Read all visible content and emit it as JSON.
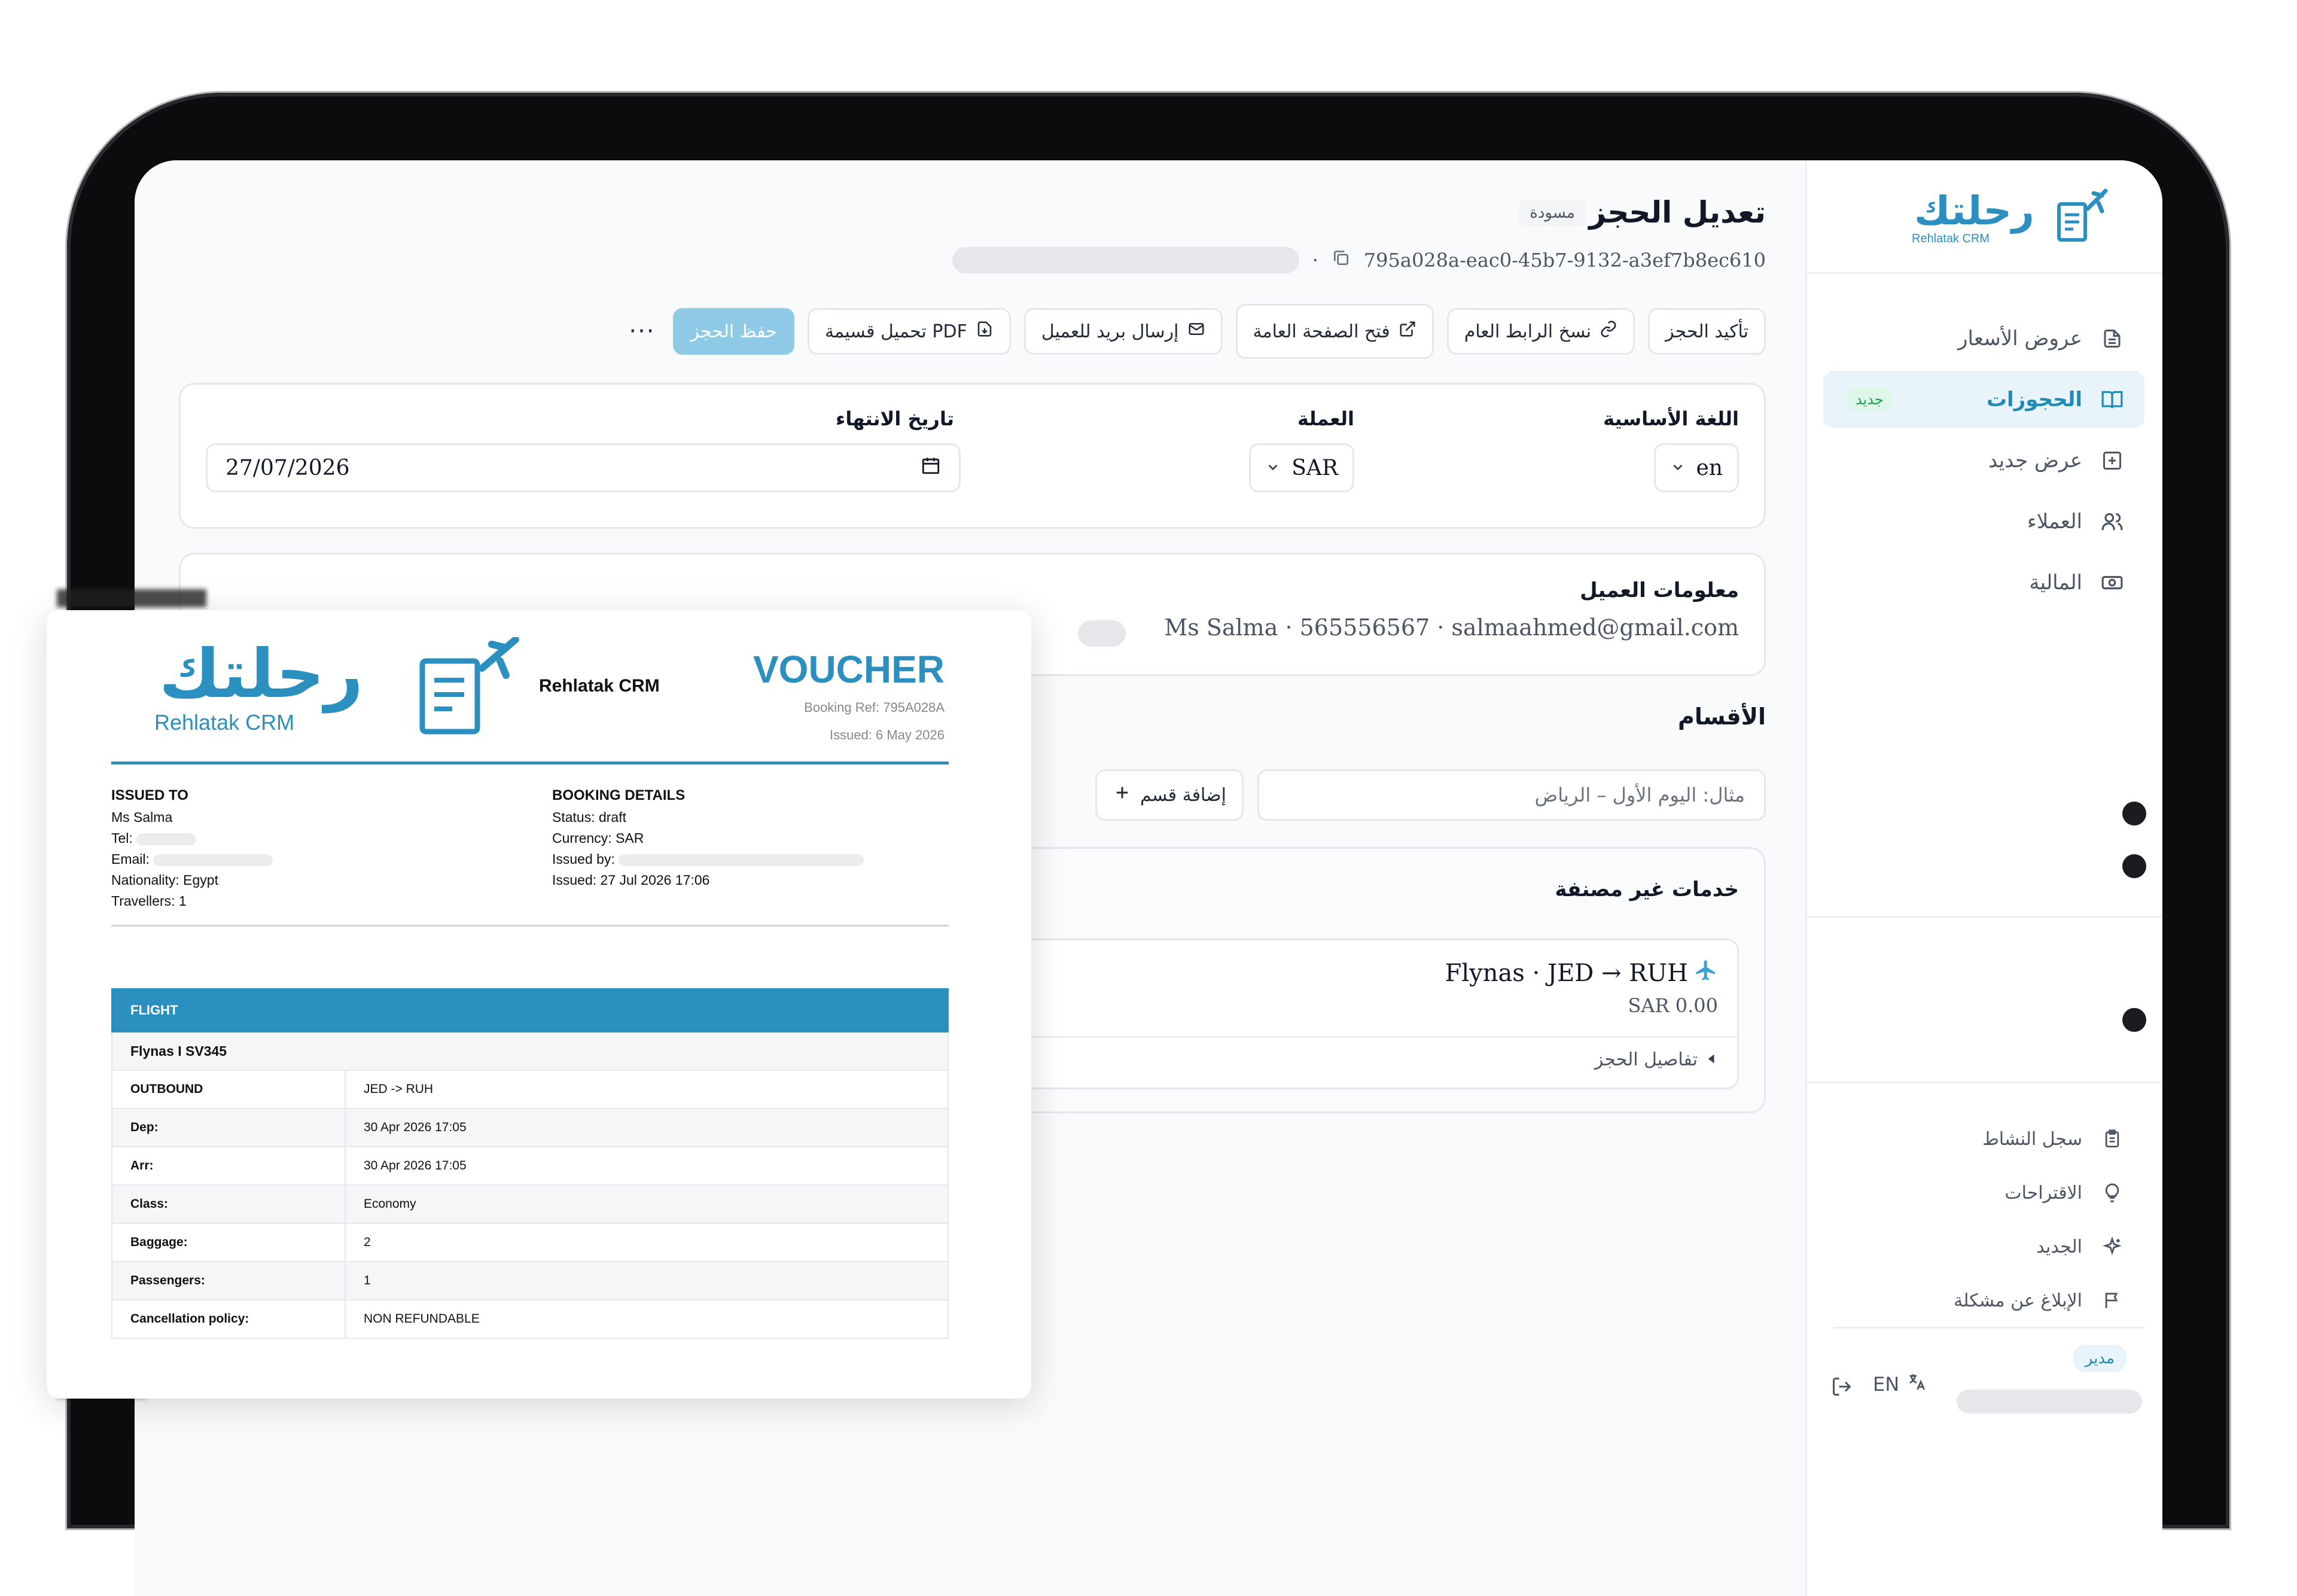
{
  "sidebar": {
    "logo_text": "رحلتك",
    "logo_sub": "Rehlatak CRM",
    "items": [
      {
        "label": "عروض الأسعار",
        "icon": "document-icon"
      },
      {
        "label": "الحجوزات",
        "icon": "book-icon",
        "badge": "جديد",
        "active": true
      },
      {
        "label": "عرض جديد",
        "icon": "plus-square-icon"
      },
      {
        "label": "العملاء",
        "icon": "users-icon"
      },
      {
        "label": "المالية",
        "icon": "cash-icon"
      }
    ],
    "bottom_items": [
      {
        "label": "سجل النشاط",
        "icon": "clipboard-icon"
      },
      {
        "label": "الاقتراحات",
        "icon": "lightbulb-icon"
      },
      {
        "label": "الجديد",
        "icon": "sparkles-icon"
      },
      {
        "label": "الإبلاغ عن مشكلة",
        "icon": "flag-icon"
      }
    ],
    "role": "مدير",
    "lang": "EN"
  },
  "header": {
    "title": "تعديل الحجز",
    "status": "مسودة",
    "booking_id": "795a028a-eac0-45b7-9132-a3ef7b8ec610",
    "separator": "·"
  },
  "actions": {
    "confirm": "تأكيد الحجز",
    "copy_link": "نسخ الرابط العام",
    "open_public": "فتح الصفحة العامة",
    "email_client": "إرسال بريد للعميل",
    "download_pdf": "تحميل قسيمة PDF",
    "save": "حفظ الحجز",
    "more": "···"
  },
  "settings": {
    "language_label": "اللغة الأساسية",
    "language_value": "en",
    "currency_label": "العملة",
    "currency_value": "SAR",
    "end_date_label": "تاريخ الانتهاء",
    "end_date_value": "27/07/2026"
  },
  "client": {
    "title": "معلومات العميل",
    "info": "Ms Salma · 565556567 · salmaahmed@gmail.com"
  },
  "sections": {
    "title": "الأقسام",
    "input_placeholder": "مثال: اليوم الأول – الرياض",
    "add_label": "إضافة قسم"
  },
  "services": {
    "title": "خدمات غير مصنفة",
    "item_name": "Flynas · JED → RUH",
    "item_price": "SAR 0.00",
    "details_label": "تفاصيل الحجز"
  },
  "voucher": {
    "company": "Rehlatak CRM",
    "title": "VOUCHER",
    "booking_ref": "Booking Ref: 795A028A",
    "issued": "Issued: 6 May 2026",
    "issued_to": {
      "heading": "ISSUED TO",
      "name": "Ms Salma",
      "tel": "Tel:",
      "email": "Email:",
      "nationality": "Nationality: Egypt",
      "travellers": "Travellers: 1"
    },
    "booking_details": {
      "heading": "BOOKING DETAILS",
      "status": "Status: draft",
      "currency": "Currency: SAR",
      "issued_by": "Issued by:",
      "issued_at": "Issued: 27 Jul 2026 17:06"
    },
    "flight": {
      "header": "FLIGHT",
      "name": "Flynas I SV345",
      "rows": [
        {
          "k": "OUTBOUND",
          "v": "JED -> RUH"
        },
        {
          "k": "Dep:",
          "v": "30 Apr 2026 17:05"
        },
        {
          "k": "Arr:",
          "v": "30 Apr 2026 17:05"
        },
        {
          "k": "Class:",
          "v": "Economy"
        },
        {
          "k": "Baggage:",
          "v": "2"
        },
        {
          "k": "Passengers:",
          "v": "1"
        },
        {
          "k": "Cancellation policy:",
          "v": "NON REFUNDABLE"
        }
      ]
    }
  },
  "colors": {
    "brand": "#2b8fbf",
    "primary_button": "#8ecae6",
    "active_nav_bg": "#e8f4fa",
    "new_badge": "#16a34a"
  }
}
